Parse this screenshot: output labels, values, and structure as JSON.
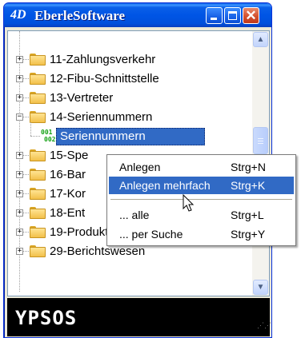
{
  "window": {
    "logo": "4D",
    "title": "EberleSoftware"
  },
  "tree": {
    "items": [
      {
        "label": "11-Zahlungsverkehr",
        "expander": "+"
      },
      {
        "label": "12-Fibu-Schnittstelle",
        "expander": "+"
      },
      {
        "label": "13-Vertreter",
        "expander": "+"
      },
      {
        "label": "14-Seriennummern",
        "expander": "−"
      },
      {
        "label": "15-Spe",
        "expander": "+"
      },
      {
        "label": "16-Bar",
        "expander": "+"
      },
      {
        "label": "17-Kor",
        "expander": "+"
      },
      {
        "label": "18-Ent",
        "expander": "+"
      },
      {
        "label": "19-Produktionsetiketten",
        "expander": "+"
      },
      {
        "label": "29-Berichtswesen",
        "expander": "+"
      }
    ],
    "selected_sub_item": {
      "label": "Seriennummern",
      "icon_line1": "001",
      "icon_line2": "002"
    }
  },
  "context_menu": {
    "items": [
      {
        "label": "Anlegen",
        "shortcut": "Strg+N"
      },
      {
        "label": "Anlegen mehrfach",
        "shortcut": "Strg+K"
      },
      {
        "label": "... alle",
        "shortcut": "Strg+L"
      },
      {
        "label": "... per Suche",
        "shortcut": "Strg+Y"
      }
    ]
  },
  "brand": {
    "text": "YPSOS"
  },
  "icons": {
    "minimize": "minimize-icon",
    "maximize": "maximize-icon",
    "close": "close-icon",
    "folder": "folder-icon",
    "serial": "serial-number-icon",
    "cursor": "mouse-pointer-icon"
  },
  "colors": {
    "titlebar": "#0055e5",
    "selection": "#316ac5",
    "brand_bar": "#000000"
  }
}
